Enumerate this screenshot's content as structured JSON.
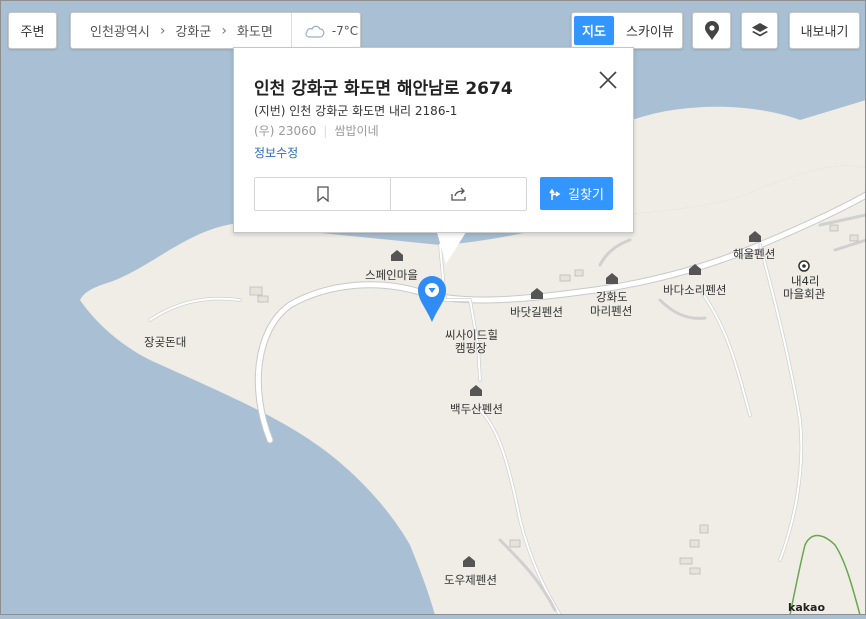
{
  "toolbar": {
    "nearby_label": "주변",
    "breadcrumb": [
      "인천광역시",
      "강화군",
      "화도면"
    ],
    "weather": {
      "icon": "cloud-icon",
      "temp": "-7°C"
    },
    "maptype": {
      "active": "지도",
      "inactive": "스카이뷰"
    },
    "export_label": "내보내기"
  },
  "popup": {
    "title": "인천 강화군 화도면 해안남로 2674",
    "jibun": "(지번) 인천 강화군 화도면 내리 2186-1",
    "zip": "(우) 23060",
    "area_name": "쌈밥이네",
    "edit_link": "정보수정",
    "route_label": "길찾기"
  },
  "map": {
    "places": {
      "spain": "스페인마을",
      "bada_gil": "바닷길펜션",
      "ganghwado": "강화도",
      "mari": "마리펜션",
      "badasori": "바다소리펜션",
      "haeul": "해울펜션",
      "naeri_top": "내4리",
      "naeri_bottom": "마을회관",
      "seaside_top": "씨사이드힐",
      "seaside_bottom": "캠핑장",
      "baekdu": "백두산펜션",
      "jang": "장곶돈대",
      "douje": "도우제펜션"
    },
    "brand": "kakao"
  },
  "colors": {
    "accent": "#3396ff",
    "sea": "#a8bfd4",
    "land": "#efede6",
    "road": "#ffffff"
  }
}
